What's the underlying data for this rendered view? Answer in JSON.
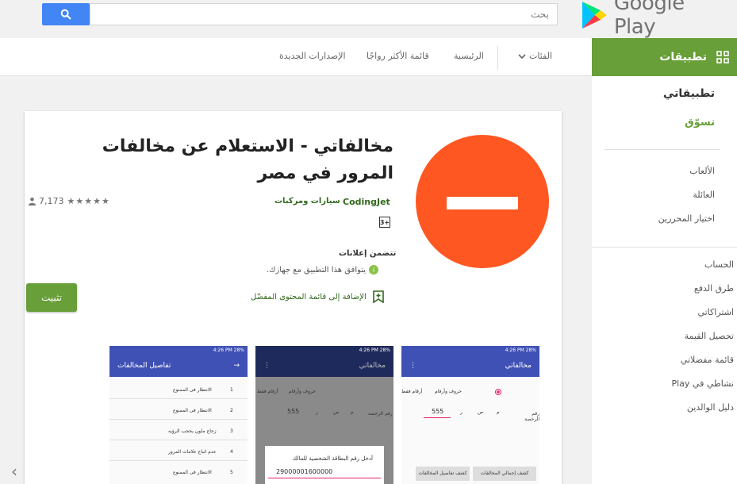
{
  "header": {
    "search_placeholder": "بحث",
    "logo_text": "Google Play"
  },
  "apps_tab": {
    "label": "تطبيقات"
  },
  "nav": {
    "categories": "الفئات",
    "home": "الرئيسية",
    "top_charts": "قائمة الأكثر رواجًا",
    "new_releases": "الإصدارات الجديدة"
  },
  "sidebar": {
    "my_apps": "تطبيقاتي",
    "shop": "تسوّق",
    "games": "الألعاب",
    "family": "العائلة",
    "editors_choice": "اختيار المحررين",
    "account": "الحساب",
    "payment_methods": "طرق الدفع",
    "subscriptions": "اشتراكاتي",
    "redeem": "تحصيل القيمة",
    "wishlist": "قائمة مفضلاتي",
    "play_activity": "نشاطي في Play",
    "parent_guide": "دليل الوالدين"
  },
  "app": {
    "title": "مخالفاتي - الاستعلام عن مخالفات المرور في مصر",
    "developer": "CodingJet",
    "category": "سيارات ومركبات",
    "rating_count": "7,173",
    "rating_stars": 5,
    "content_rating": "3+",
    "contains_ads": "تتضمن إعلانات",
    "compatibility": "يتوافق هذا التطبيق مع جهازك.",
    "wishlist": "الإضافة إلى قائمة المحتوى المفضّل",
    "install": "تثبيت"
  },
  "screenshots": [
    {
      "status": "4:26 PM  28%",
      "appbar": "مخالفاتي",
      "radio_1": "حروف وأرقام",
      "radio_2": "أرقام فقط",
      "plate_label": "رقم الرخصة",
      "plate_number": "555",
      "letters": [
        "م",
        "ص",
        "ر"
      ],
      "button_1": "كشف إجمالي المخالفات",
      "button_2": "كشف تفاصيل المخالفات"
    },
    {
      "status": "4:26 PM  28%",
      "appbar": "مخالفاتي",
      "radio_1": "حروف وأرقام",
      "radio_2": "أرقام فقط",
      "plate_label": "رقم الرخصة",
      "plate_number": "555",
      "letters": [
        "م",
        "ص",
        "ر"
      ],
      "dialog_prompt": "أدخل رقم البطاقة الشخصية للمالك",
      "dialog_value": "29000001600000"
    },
    {
      "status": "4:26 PM  28%",
      "appbar": "تفاصيل المخالفات",
      "rows": [
        {
          "n": "1",
          "text": "الانتظار فى الممنوع"
        },
        {
          "n": "2",
          "text": "الانتظار فى الممنوع"
        },
        {
          "n": "3",
          "text": "زجاج ملون يحجب الرؤيه"
        },
        {
          "n": "4",
          "text": "عدم اتباع علامات المرور"
        },
        {
          "n": "5",
          "text": "الانتظار فى الممنوع"
        }
      ]
    }
  ],
  "colors": {
    "brand_green": "#689f38",
    "search_blue": "#4285f4",
    "icon_orange": "#ff5722",
    "app_indigo": "#3f51b5"
  }
}
